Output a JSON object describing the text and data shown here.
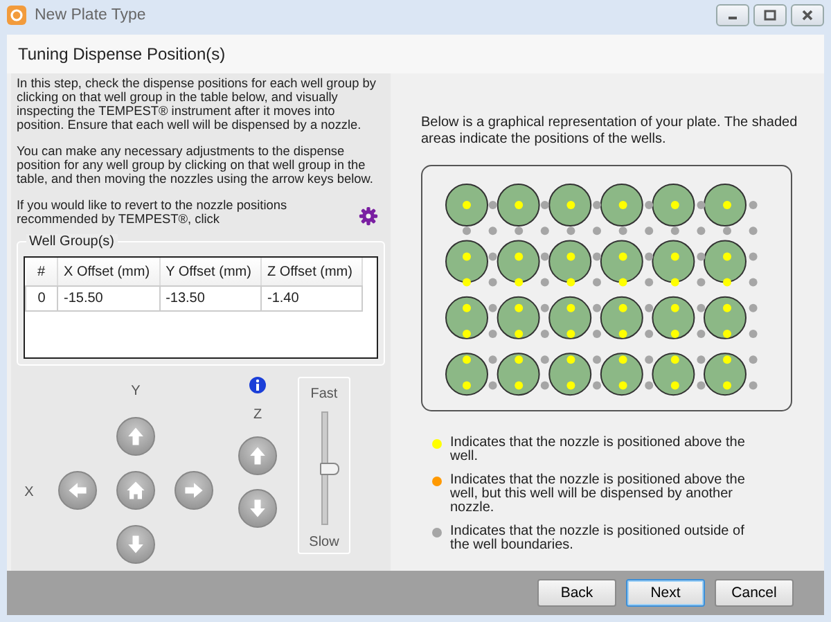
{
  "window": {
    "title": "New Plate Type"
  },
  "step_title": "Tuning Dispense Position(s)",
  "instructions": [
    "In this step, check the dispense positions for each well group by clicking on that well group in the table below, and visually inspecting the TEMPEST® instrument after it moves into position. Ensure that each well will be dispensed by a nozzle.",
    "You can make any necessary adjustments to the dispense position for any well group by clicking on that well group in the table, and then moving the nozzles using the arrow keys below.",
    "If you would like to revert to the nozzle positions recommended by TEMPEST®, click"
  ],
  "well_groups": {
    "legend": "Well Group(s)",
    "columns": [
      "#",
      "X Offset (mm)",
      "Y Offset (mm)",
      "Z Offset (mm)"
    ],
    "rows": [
      [
        "0",
        "-15.50",
        "-13.50",
        "-1.40"
      ]
    ]
  },
  "jog": {
    "y_label": "Y",
    "x_label": "X",
    "z_label": "Z"
  },
  "speed": {
    "fast": "Fast",
    "slow": "Slow",
    "level": 0.5
  },
  "plate_description": "Below is a graphical representation of your plate. The shaded areas indicate the positions of the wells.",
  "legend": [
    {
      "color": "#ffff00",
      "text": "Indicates that the nozzle is positioned above the well."
    },
    {
      "color": "#ff9900",
      "text": "Indicates that the nozzle is positioned above the well, but this well will be dispensed by another nozzle."
    },
    {
      "color": "#a6a6a6",
      "text": "Indicates that the nozzle is positioned outside of the well boundaries."
    }
  ],
  "buttons": [
    {
      "label": "Back",
      "focused": false
    },
    {
      "label": "Next",
      "focused": true
    },
    {
      "label": "Cancel",
      "focused": false
    }
  ]
}
